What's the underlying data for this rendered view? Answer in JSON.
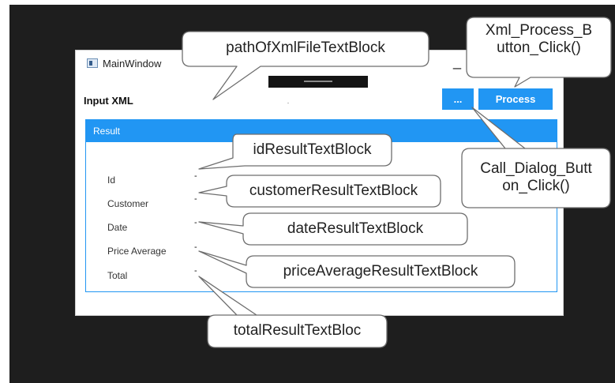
{
  "window": {
    "title": "MainWindow",
    "minimize_label": "_",
    "input_label": "Input XML",
    "browse_button_label": "...",
    "process_button_label": "Process"
  },
  "result": {
    "header": "Result",
    "fields": [
      {
        "label": "Id",
        "value": "-"
      },
      {
        "label": "Customer",
        "value": "-"
      },
      {
        "label": "Date",
        "value": "-"
      },
      {
        "label": "Price Average",
        "value": "-"
      },
      {
        "label": "Total",
        "value": "-"
      }
    ]
  },
  "callouts": {
    "path_of_xml": "pathOfXmlFileTextBlock",
    "xml_process_line1": "Xml_Process_B",
    "xml_process_line2": "utton_Click()",
    "call_dialog_line1": "Call_Dialog_Butt",
    "call_dialog_line2": "on_Click()",
    "id_result": "idResultTextBlock",
    "customer_result": "customerResultTextBlock",
    "date_result": "dateResultTextBlock",
    "price_average_result": "priceAverageResultTextBlock",
    "total_result": "totalResultTextBloc"
  },
  "colors": {
    "accent": "#2196f3",
    "background": "#1e1e1e",
    "callout_fill": "#ffffff",
    "callout_stroke": "#6e6e6e"
  },
  "icons": {
    "window_icon": "app-window-icon"
  }
}
